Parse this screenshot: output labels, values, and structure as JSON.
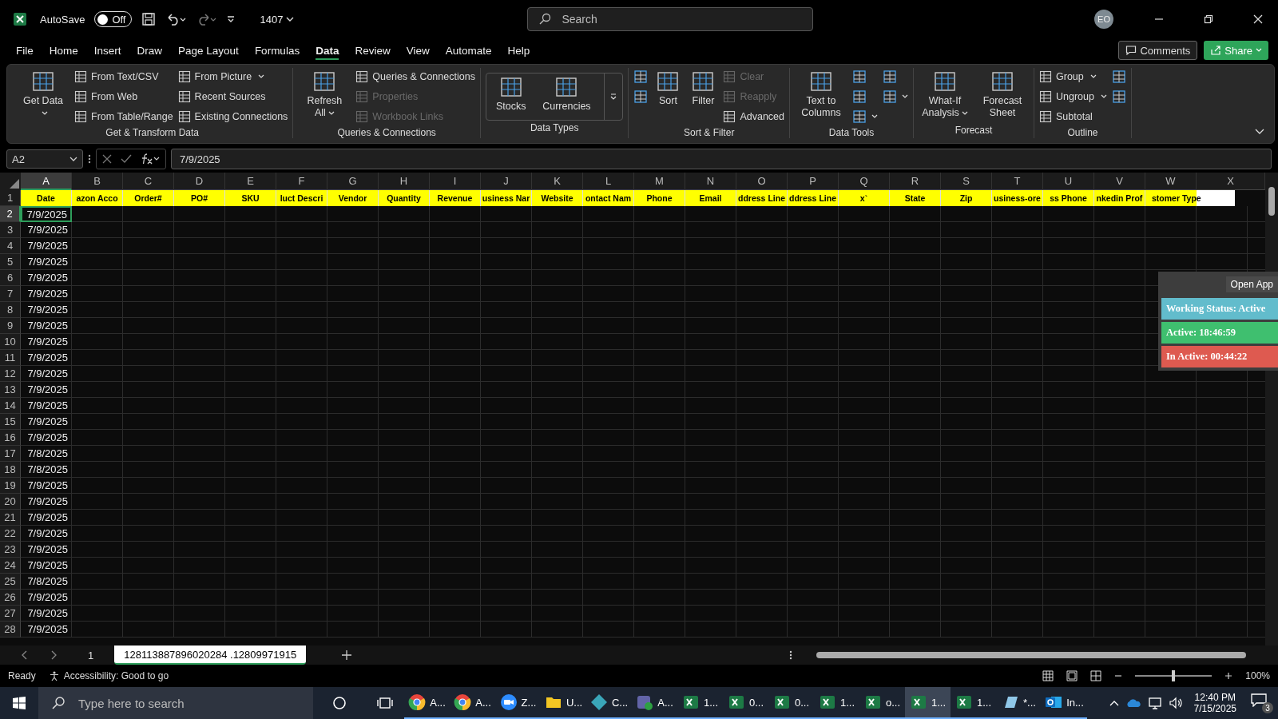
{
  "title_bar": {
    "autosave_label": "AutoSave",
    "autosave": {
      "label": "Off",
      "on": false
    },
    "file_name": "1407",
    "search": {
      "placeholder": "Search"
    },
    "avatar": "EO"
  },
  "menu_tabs": [
    {
      "label": "File",
      "selected": false
    },
    {
      "label": "Home",
      "selected": false
    },
    {
      "label": "Insert",
      "selected": false
    },
    {
      "label": "Draw",
      "selected": false
    },
    {
      "label": "Page Layout",
      "selected": false
    },
    {
      "label": "Formulas",
      "selected": false
    },
    {
      "label": "Data",
      "selected": true
    },
    {
      "label": "Review",
      "selected": false
    },
    {
      "label": "View",
      "selected": false
    },
    {
      "label": "Automate",
      "selected": false
    },
    {
      "label": "Help",
      "selected": false
    }
  ],
  "comments_button": "Comments",
  "share_button": "Share",
  "ribbon_groups": [
    {
      "title": "Get & Transform Data",
      "kind": "buttons",
      "columns": [
        [
          {
            "kind": "large",
            "label": "Get Data",
            "dropdown": true,
            "disabled": false
          }
        ],
        [
          {
            "kind": "small",
            "label": "From Text/CSV",
            "dropdown": false,
            "disabled": false
          },
          {
            "kind": "small",
            "label": "From Web",
            "dropdown": false,
            "disabled": false
          },
          {
            "kind": "small",
            "label": "From Table/Range",
            "dropdown": false,
            "disabled": false
          }
        ],
        [
          {
            "kind": "small",
            "label": "From Picture",
            "dropdown": true,
            "disabled": false
          },
          {
            "kind": "small",
            "label": "Recent Sources",
            "dropdown": false,
            "disabled": false
          },
          {
            "kind": "small",
            "label": "Existing Connections",
            "dropdown": false,
            "disabled": false
          }
        ]
      ]
    },
    {
      "title": "Queries & Connections",
      "kind": "buttons",
      "columns": [
        [
          {
            "kind": "large",
            "label": "Refresh All",
            "dropdown": true,
            "disabled": false
          }
        ],
        [
          {
            "kind": "small",
            "label": "Queries & Connections",
            "dropdown": false,
            "disabled": false
          },
          {
            "kind": "small",
            "label": "Properties",
            "dropdown": false,
            "disabled": true
          },
          {
            "kind": "small",
            "label": "Workbook Links",
            "dropdown": false,
            "disabled": true
          }
        ]
      ]
    },
    {
      "title": "Data Types",
      "kind": "gallery",
      "columns": [
        [
          {
            "kind": "large",
            "label": "Stocks",
            "dropdown": false,
            "disabled": false
          }
        ],
        [
          {
            "kind": "large",
            "label": "Currencies",
            "dropdown": false,
            "disabled": false
          }
        ]
      ]
    },
    {
      "title": "Sort & Filter",
      "kind": "buttons",
      "columns": [
        [
          {
            "kind": "icon",
            "dropdown": false,
            "disabled": false
          },
          {
            "kind": "icon",
            "dropdown": false,
            "disabled": false
          }
        ],
        [
          {
            "kind": "large",
            "label": "Sort",
            "dropdown": false,
            "disabled": false
          }
        ],
        [
          {
            "kind": "large",
            "label": "Filter",
            "dropdown": false,
            "disabled": false
          }
        ],
        [
          {
            "kind": "small",
            "label": "Clear",
            "dropdown": false,
            "disabled": true
          },
          {
            "kind": "small",
            "label": "Reapply",
            "dropdown": false,
            "disabled": true
          },
          {
            "kind": "small",
            "label": "Advanced",
            "dropdown": false,
            "disabled": false
          }
        ]
      ]
    },
    {
      "title": "Data Tools",
      "kind": "buttons",
      "columns": [
        [
          {
            "kind": "large",
            "label": "Text to Columns",
            "dropdown": false,
            "disabled": false
          }
        ],
        [
          {
            "kind": "icon",
            "dropdown": false,
            "disabled": false
          },
          {
            "kind": "icon",
            "dropdown": false,
            "disabled": false
          },
          {
            "kind": "icon",
            "dropdown": true,
            "disabled": false
          }
        ],
        [
          {
            "kind": "icon",
            "dropdown": false,
            "disabled": false
          },
          {
            "kind": "icon",
            "dropdown": true,
            "disabled": false
          }
        ]
      ]
    },
    {
      "title": "Forecast",
      "kind": "buttons",
      "columns": [
        [
          {
            "kind": "large",
            "label": "What-If Analysis",
            "dropdown": true,
            "disabled": false
          }
        ],
        [
          {
            "kind": "large",
            "label": "Forecast Sheet",
            "dropdown": false,
            "disabled": false
          }
        ]
      ]
    },
    {
      "title": "Outline",
      "kind": "buttons",
      "columns": [
        [
          {
            "kind": "small",
            "label": "Group",
            "dropdown": true,
            "disabled": false
          },
          {
            "kind": "small",
            "label": "Ungroup",
            "dropdown": true,
            "disabled": false
          },
          {
            "kind": "small",
            "label": "Subtotal",
            "dropdown": false,
            "disabled": false
          }
        ],
        [
          {
            "kind": "icon",
            "dropdown": false,
            "disabled": false
          },
          {
            "kind": "icon",
            "dropdown": false,
            "disabled": false
          }
        ]
      ]
    }
  ],
  "name_box": "A2",
  "formula": "7/9/2025",
  "columns": [
    {
      "label": "A",
      "selected": true
    },
    {
      "label": "B",
      "selected": false
    },
    {
      "label": "C",
      "selected": false
    },
    {
      "label": "D",
      "selected": false
    },
    {
      "label": "E",
      "selected": false
    },
    {
      "label": "F",
      "selected": false
    },
    {
      "label": "G",
      "selected": false
    },
    {
      "label": "H",
      "selected": false
    },
    {
      "label": "I",
      "selected": false
    },
    {
      "label": "J",
      "selected": false
    },
    {
      "label": "K",
      "selected": false
    },
    {
      "label": "L",
      "selected": false
    },
    {
      "label": "M",
      "selected": false
    },
    {
      "label": "N",
      "selected": false
    },
    {
      "label": "O",
      "selected": false
    },
    {
      "label": "P",
      "selected": false
    },
    {
      "label": "Q",
      "selected": false
    },
    {
      "label": "R",
      "selected": false
    },
    {
      "label": "S",
      "selected": false
    },
    {
      "label": "T",
      "selected": false
    },
    {
      "label": "U",
      "selected": false
    },
    {
      "label": "V",
      "selected": false
    },
    {
      "label": "W",
      "selected": false
    },
    {
      "label": "X",
      "selected": false
    }
  ],
  "header_row": {
    "number": "1",
    "cells": [
      "Date",
      "azon Acco",
      "Order#",
      "PO#",
      "SKU",
      "luct Descri",
      "Vendor",
      "Quantity",
      "Revenue",
      "usiness Nar",
      "Website",
      "ontact Nam",
      "Phone",
      "Email",
      "ddress Line",
      "ddress Line",
      "x`",
      "State",
      "Zip",
      "usiness-ore",
      "ss Phone",
      "nkedin Prof",
      "stomer Type"
    ]
  },
  "rows": [
    {
      "number": "2",
      "date": "7/9/2025",
      "selected": true
    },
    {
      "number": "3",
      "date": "7/9/2025",
      "selected": false
    },
    {
      "number": "4",
      "date": "7/9/2025",
      "selected": false
    },
    {
      "number": "5",
      "date": "7/9/2025",
      "selected": false
    },
    {
      "number": "6",
      "date": "7/9/2025",
      "selected": false
    },
    {
      "number": "7",
      "date": "7/9/2025",
      "selected": false
    },
    {
      "number": "8",
      "date": "7/9/2025",
      "selected": false
    },
    {
      "number": "9",
      "date": "7/9/2025",
      "selected": false
    },
    {
      "number": "10",
      "date": "7/9/2025",
      "selected": false
    },
    {
      "number": "11",
      "date": "7/9/2025",
      "selected": false
    },
    {
      "number": "12",
      "date": "7/9/2025",
      "selected": false
    },
    {
      "number": "13",
      "date": "7/9/2025",
      "selected": false
    },
    {
      "number": "14",
      "date": "7/9/2025",
      "selected": false
    },
    {
      "number": "15",
      "date": "7/9/2025",
      "selected": false
    },
    {
      "number": "16",
      "date": "7/9/2025",
      "selected": false
    },
    {
      "number": "17",
      "date": "7/8/2025",
      "selected": false
    },
    {
      "number": "18",
      "date": "7/8/2025",
      "selected": false
    },
    {
      "number": "19",
      "date": "7/9/2025",
      "selected": false
    },
    {
      "number": "20",
      "date": "7/9/2025",
      "selected": false
    },
    {
      "number": "21",
      "date": "7/9/2025",
      "selected": false
    },
    {
      "number": "22",
      "date": "7/9/2025",
      "selected": false
    },
    {
      "number": "23",
      "date": "7/9/2025",
      "selected": false
    },
    {
      "number": "24",
      "date": "7/9/2025",
      "selected": false
    },
    {
      "number": "25",
      "date": "7/8/2025",
      "selected": false
    },
    {
      "number": "26",
      "date": "7/9/2025",
      "selected": false
    },
    {
      "number": "27",
      "date": "7/9/2025",
      "selected": false
    },
    {
      "number": "28",
      "date": "7/9/2025",
      "selected": false
    }
  ],
  "sheet_tabs": [
    {
      "label": "1",
      "selected": false
    },
    {
      "label": "128113887896020284 .12809971915",
      "selected": true
    }
  ],
  "status_bar": {
    "status": "Ready",
    "accessibility": "Accessibility: Good to go",
    "zoom_slider": {
      "level": 0.5
    },
    "zoom": "100%"
  },
  "time_tracker": {
    "open_button": "Open App",
    "lines": [
      {
        "text": "Working Status: Active",
        "color": "#62bccc"
      },
      {
        "text": "Active: 18:46:59",
        "color": "#3fbf6f"
      },
      {
        "text": "In Active: 00:44:22",
        "color": "#de5a50"
      }
    ]
  },
  "taskbar": {
    "search_placeholder": "Type here to search",
    "apps": [
      {
        "kind": "browser",
        "label": "A...",
        "selected": false
      },
      {
        "kind": "browser",
        "label": "A...",
        "selected": false
      },
      {
        "kind": "video",
        "label": "Z...",
        "selected": false
      },
      {
        "kind": "folder",
        "label": "U...",
        "selected": false
      },
      {
        "kind": "diamond",
        "label": "C...",
        "selected": false
      },
      {
        "kind": "chat",
        "label": "A...",
        "selected": false
      },
      {
        "kind": "sheet",
        "label": "1...",
        "selected": false
      },
      {
        "kind": "sheet",
        "label": "0...",
        "selected": false
      },
      {
        "kind": "sheet",
        "label": "0...",
        "selected": false
      },
      {
        "kind": "sheet",
        "label": "1...",
        "selected": false
      },
      {
        "kind": "sheet",
        "label": "o...",
        "selected": false
      },
      {
        "kind": "sheet",
        "label": "1...",
        "selected": true
      },
      {
        "kind": "sheet",
        "label": "1...",
        "selected": false
      },
      {
        "kind": "notepad",
        "label": "*...",
        "selected": false
      },
      {
        "kind": "mail",
        "label": "In...",
        "selected": false
      }
    ],
    "time": "12:40 PM",
    "date": "7/15/2025",
    "notifications": "3"
  }
}
